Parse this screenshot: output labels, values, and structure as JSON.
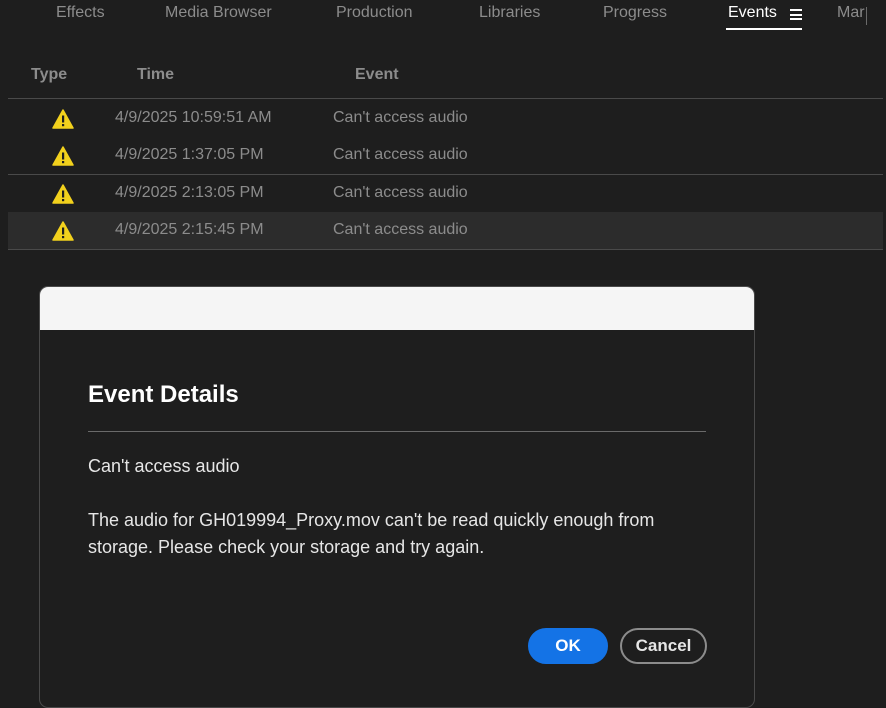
{
  "tabs": [
    {
      "label": "Effects"
    },
    {
      "label": "Media Browser"
    },
    {
      "label": "Production"
    },
    {
      "label": "Libraries"
    },
    {
      "label": "Progress"
    },
    {
      "label": "Events",
      "active": true
    },
    {
      "label": "Mar"
    }
  ],
  "table": {
    "columns": [
      "Type",
      "Time",
      "Event"
    ],
    "rows": [
      {
        "type_icon": "warning-icon",
        "time": "4/9/2025 10:59:51 AM",
        "event": "Can't access audio"
      },
      {
        "type_icon": "warning-icon",
        "time": "4/9/2025 1:37:05 PM",
        "event": "Can't access audio"
      },
      {
        "type_icon": "warning-icon",
        "time": "4/9/2025 2:13:05 PM",
        "event": "Can't access audio"
      },
      {
        "type_icon": "warning-icon",
        "time": "4/9/2025 2:15:45 PM",
        "event": "Can't access audio",
        "selected": true
      }
    ]
  },
  "dialog": {
    "title": "Event Details",
    "subtitle": "Can't access audio",
    "body": "The audio for GH019994_Proxy.mov can't be read quickly enough from storage. Please check your storage and try again.",
    "ok_label": "OK",
    "cancel_label": "Cancel"
  },
  "colors": {
    "accent": "#1473e6",
    "warning": "#f2d11d",
    "background": "#1e1e1e"
  }
}
